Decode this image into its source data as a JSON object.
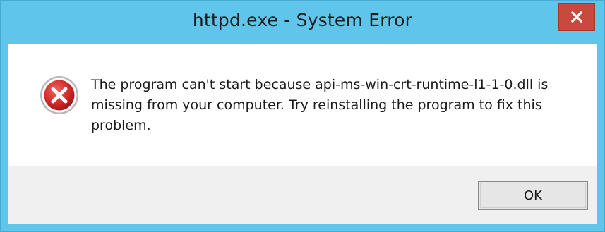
{
  "window": {
    "title": "httpd.exe - System Error",
    "close_label": "×"
  },
  "dialog": {
    "icon": "error-icon",
    "message": "The program can't start because api-ms-win-crt-runtime-l1-1-0.dll is missing from your computer. Try reinstalling the program to fix this problem."
  },
  "buttons": {
    "ok_label": "OK"
  },
  "colors": {
    "titlebar": "#5fc5ea",
    "close_button": "#c84a3e",
    "footer": "#f0f0f0",
    "error_red": "#c8242a"
  }
}
